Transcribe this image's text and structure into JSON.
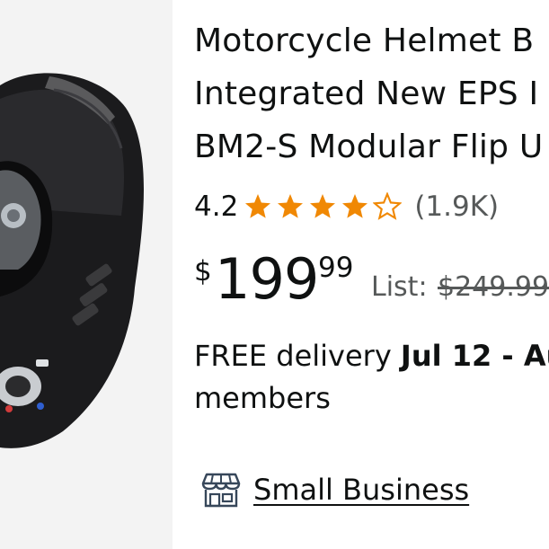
{
  "product": {
    "title_lines": [
      "Motorcycle Helmet B",
      "Integrated New EPS I",
      "BM2-S Modular Flip U"
    ],
    "image_icon": "helmet-product-image"
  },
  "rating": {
    "value": "4.2",
    "stars": 4.2,
    "count": "(1.9K)",
    "star_color": "#f08804",
    "star_icon": "star-icon"
  },
  "price": {
    "symbol": "$",
    "whole": "199",
    "fraction": "99",
    "list_label": "List:",
    "list_price": "$249.99"
  },
  "delivery": {
    "prefix": "FREE delivery ",
    "dates": "Jul 12 - Au",
    "line2": "members"
  },
  "badge": {
    "icon": "storefront-icon",
    "label": "Small Business"
  }
}
